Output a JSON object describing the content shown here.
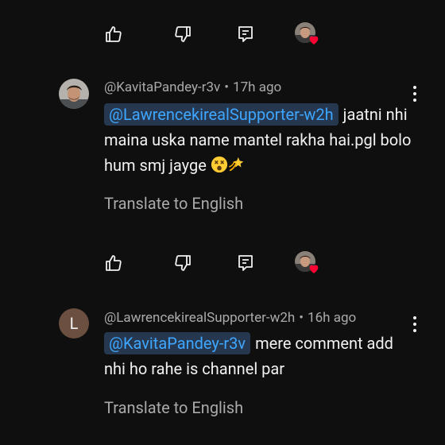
{
  "colors": {
    "background": "#0f0f0f",
    "text_primary": "#f1f1f1",
    "text_secondary": "#aaaaaa",
    "mention_text": "#3ea6ff",
    "mention_bg": "#263850",
    "heart": "#ff0033",
    "letter_avatar_bg": "#6b4f40"
  },
  "icons": {
    "like": "thumb-up-icon",
    "dislike": "thumb-down-icon",
    "reply": "reply-comment-icon",
    "creator_heart": "heart-icon",
    "more": "more-vertical-icon"
  },
  "comments": [
    {
      "author": "@KavitaPandey-r3v",
      "separator": "•",
      "time": "17h ago",
      "avatar_type": "photo",
      "mention": "@LawrencekirealSupporter-w2h",
      "text": "jaatni nhi maina uska name mantel rakha hai.pgl bolo hum smj jayge",
      "emojis": [
        "dizzy-face-emoji",
        "dizzy-star-emoji"
      ],
      "translate": "Translate to English"
    },
    {
      "author": "@LawrencekirealSupporter-w2h",
      "separator": "•",
      "time": "16h ago",
      "avatar_type": "letter",
      "avatar_letter": "L",
      "mention": "@KavitaPandey-r3v",
      "text": "mere comment add nhi ho rahe is channel par",
      "emojis": [],
      "translate": "Translate to English"
    }
  ]
}
